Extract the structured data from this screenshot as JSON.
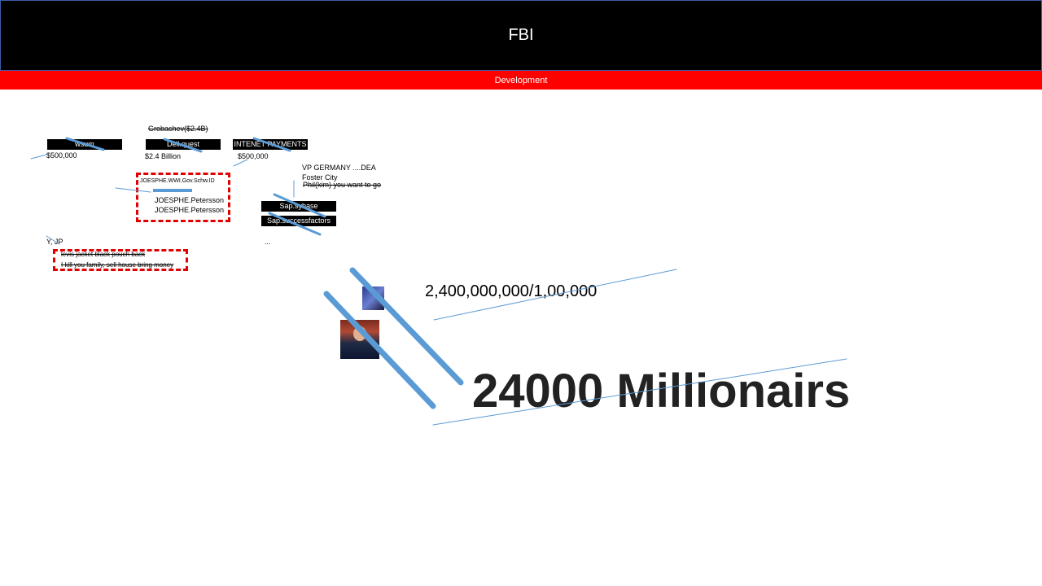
{
  "header": {
    "title": "FBI"
  },
  "subbar": {
    "label": "Development"
  },
  "notes": {
    "wsum_label": "wsum",
    "wsum_amount": "$500,000",
    "grobachev": "Grobachev($2.4B)",
    "dell_label": "Dell.quest",
    "dell_amount": "$2.4 Billion",
    "internet_label": "INTENET PAYMENTS",
    "internet_amount": "$500,000",
    "vp_line1": "VP GERMANY ....DEA",
    "vp_line2": "Foster City",
    "vp_line3": "Phil(kim) you want to go",
    "box1_title": "JOESPHE.WWI.Gov.Schw.ID",
    "box1_name1": "JOESPHE.Petersson",
    "box1_name2": "JOESPHE.Petersson",
    "sap_sybase": "Sap.sybase",
    "sap_success": "Sap.successfactors",
    "ellipsis": "...",
    "yjp": "Y, JP",
    "box2_line1": "levis jacket black pouch back",
    "box2_line2": "I kill you family, sell house bring money"
  },
  "main": {
    "calc": "2,400,000,000/1,00,000",
    "headline": "24000 Millionairs"
  },
  "colors": {
    "header": "#000000",
    "subbar": "#ff0000",
    "dash": "#e00000",
    "stroke": "#5b9bd5"
  }
}
